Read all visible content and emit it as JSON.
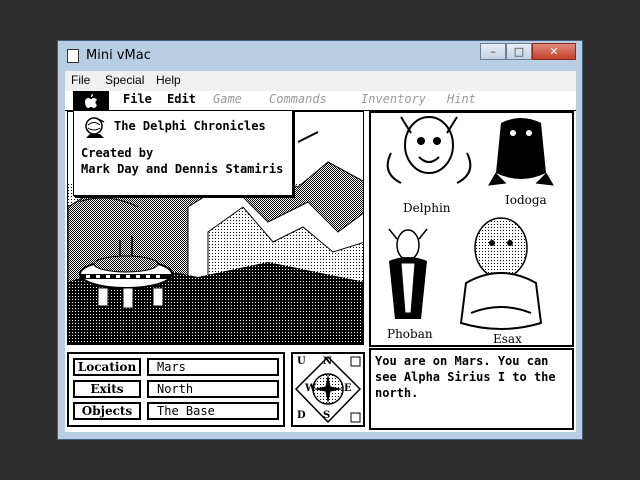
{
  "window": {
    "title": "Mini vMac",
    "buttons": {
      "minimize": "–",
      "maximize": "□",
      "close": "✕"
    }
  },
  "host_menu": [
    "File",
    "Special",
    "Help"
  ],
  "mac_menu": {
    "apple_icon": "apple-logo",
    "items": [
      "File",
      "Edit",
      "Game",
      "Commands",
      "Inventory",
      "Hint"
    ]
  },
  "about": {
    "title": "The Delphi Chronicles",
    "line2": "Created by",
    "line3": "Mark Day and Dennis Stamiris"
  },
  "characters": {
    "delphin": "Delphin",
    "iodoga": "Iodoga",
    "phoban": "Phoban",
    "esax": "Esax"
  },
  "info": {
    "location_label": "Location",
    "location_value": "Mars",
    "exits_label": "Exits",
    "exits_value": "North",
    "objects_label": "Objects",
    "objects_value": "The Base"
  },
  "compass": {
    "n": "N",
    "s": "S",
    "e": "E",
    "w": "W",
    "u": "U",
    "d": "D"
  },
  "message": "You are on Mars. You can see Alpha Sirius I to the north."
}
